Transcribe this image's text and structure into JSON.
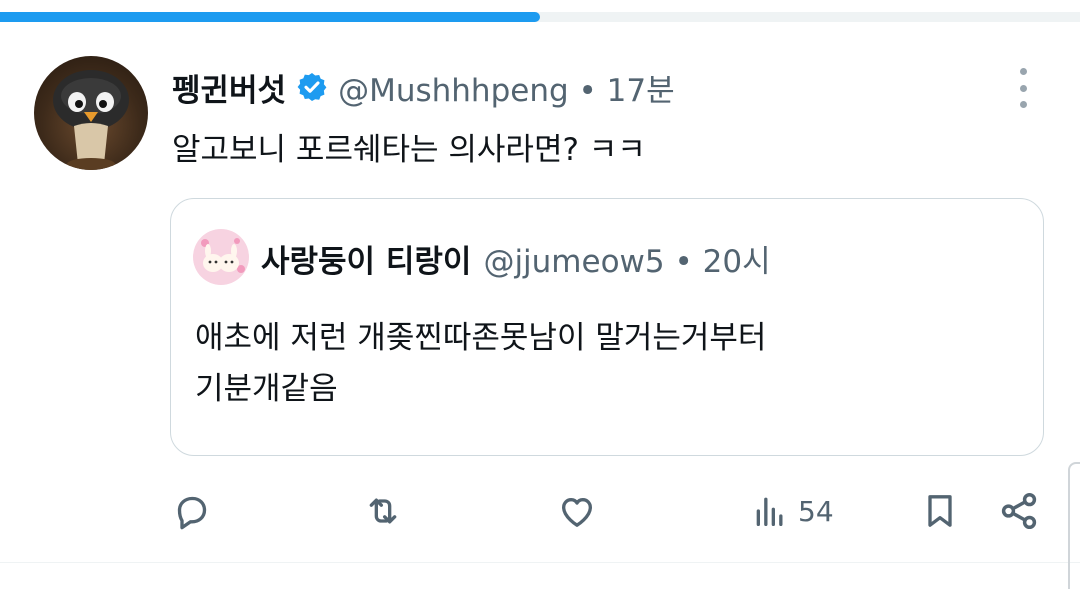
{
  "progress": {
    "fraction": 0.5
  },
  "tweet": {
    "author_name": "펭귄버섯",
    "handle": "@Mushhhpeng",
    "separator": "•",
    "time": "17분",
    "text": "알고보니 포르쉐타는 의사라면? ㅋㅋ"
  },
  "quote": {
    "author_name": "사랑둥이 티랑이",
    "handle": "@jjumeow5",
    "separator": "•",
    "time": "20시",
    "text_line1": "애초에 저런 개좆찐따존못남이 말거는거부터",
    "text_line2": "기분개같음"
  },
  "actions": {
    "views": "54"
  },
  "icons": {
    "reply": "reply-icon",
    "retweet": "retweet-icon",
    "like": "heart-icon",
    "views": "views-chart-icon",
    "bookmark": "bookmark-icon",
    "share": "share-icon",
    "more": "more-vertical-icon",
    "verified": "verified-badge-icon"
  },
  "colors": {
    "accent": "#1d9bf0",
    "text_primary": "#0f1419",
    "text_secondary": "#536471",
    "border": "#cfd9de"
  }
}
